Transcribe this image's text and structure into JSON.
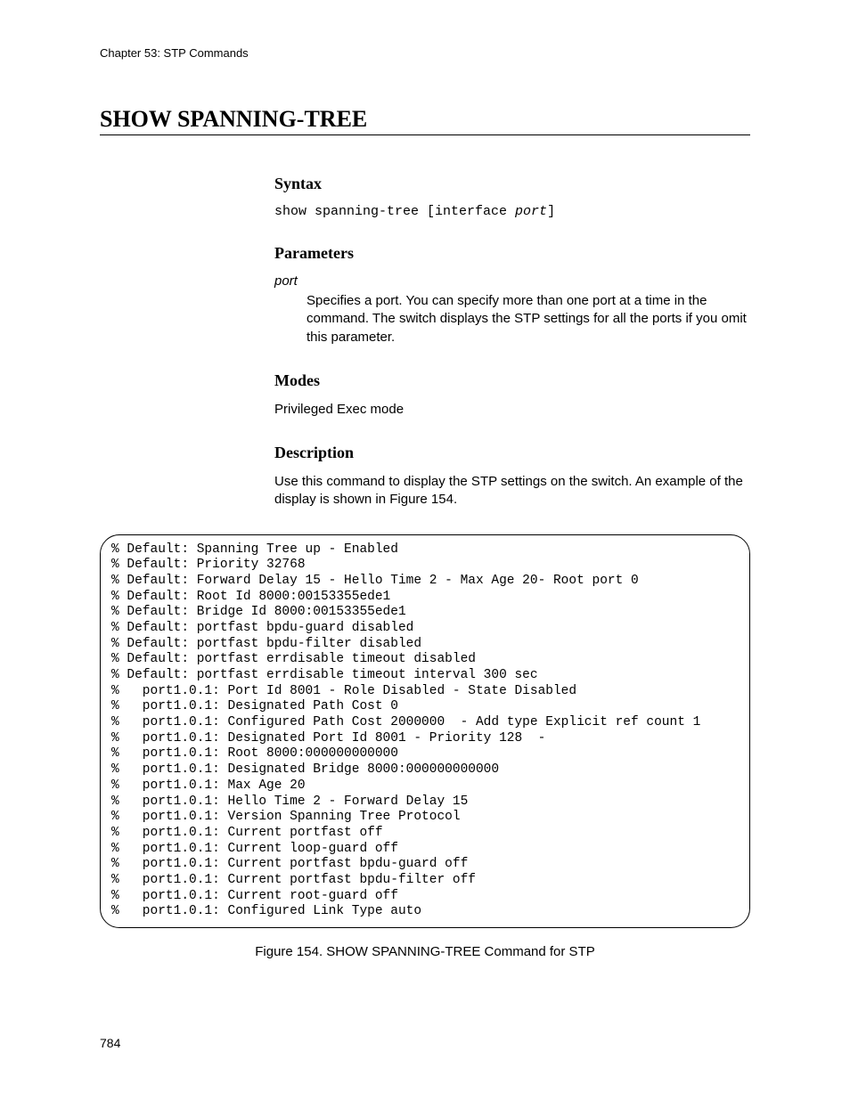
{
  "header": {
    "chapter": "Chapter 53: STP Commands"
  },
  "title": "SHOW SPANNING-TREE",
  "syntax": {
    "heading": "Syntax",
    "cmd_prefix": "show spanning-tree [interface ",
    "cmd_param": "port",
    "cmd_suffix": "]"
  },
  "parameters": {
    "heading": "Parameters",
    "name": "port",
    "desc": "Specifies a port. You can specify more than one port at a time in the command. The switch displays the STP settings for all the ports if you omit this parameter."
  },
  "modes": {
    "heading": "Modes",
    "text": "Privileged Exec mode"
  },
  "description": {
    "heading": "Description",
    "text": "Use this command to display the STP settings on the switch. An example of the display is shown in Figure 154."
  },
  "output_lines": "% Default: Spanning Tree up - Enabled\n% Default: Priority 32768\n% Default: Forward Delay 15 - Hello Time 2 - Max Age 20- Root port 0\n% Default: Root Id 8000:00153355ede1\n% Default: Bridge Id 8000:00153355ede1\n% Default: portfast bpdu-guard disabled\n% Default: portfast bpdu-filter disabled\n% Default: portfast errdisable timeout disabled\n% Default: portfast errdisable timeout interval 300 sec\n%   port1.0.1: Port Id 8001 - Role Disabled - State Disabled\n%   port1.0.1: Designated Path Cost 0\n%   port1.0.1: Configured Path Cost 2000000  - Add type Explicit ref count 1\n%   port1.0.1: Designated Port Id 8001 - Priority 128  -\n%   port1.0.1: Root 8000:000000000000\n%   port1.0.1: Designated Bridge 8000:000000000000\n%   port1.0.1: Max Age 20\n%   port1.0.1: Hello Time 2 - Forward Delay 15\n%   port1.0.1: Version Spanning Tree Protocol\n%   port1.0.1: Current portfast off\n%   port1.0.1: Current loop-guard off\n%   port1.0.1: Current portfast bpdu-guard off\n%   port1.0.1: Current portfast bpdu-filter off\n%   port1.0.1: Current root-guard off\n%   port1.0.1: Configured Link Type auto",
  "figure_caption": "Figure 154. SHOW SPANNING-TREE Command for STP",
  "page_number": "784"
}
